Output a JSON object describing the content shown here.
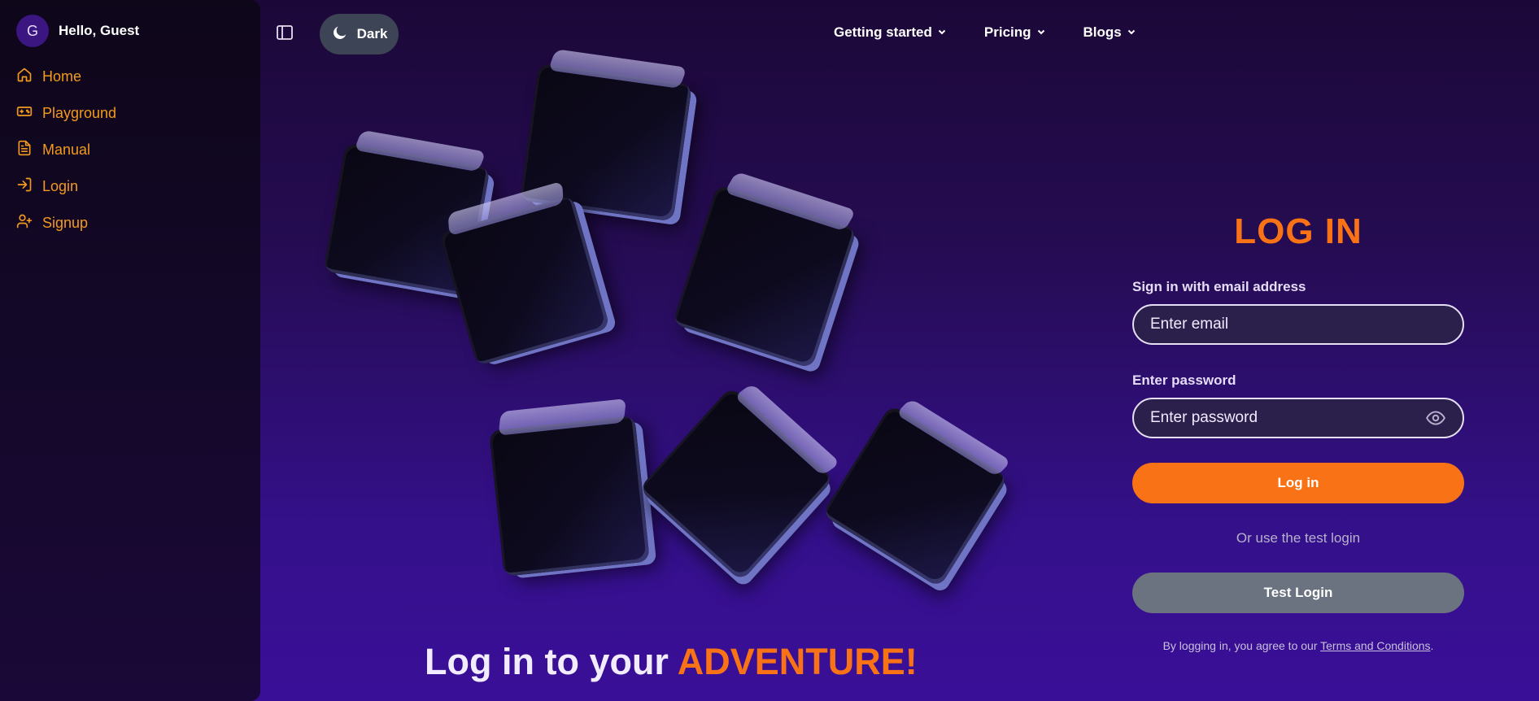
{
  "user": {
    "avatar_initial": "G",
    "greeting": "Hello, Guest"
  },
  "sidebar": {
    "items": [
      {
        "label": "Home",
        "icon": "home-icon"
      },
      {
        "label": "Playground",
        "icon": "gamepad-icon"
      },
      {
        "label": "Manual",
        "icon": "document-icon"
      },
      {
        "label": "Login",
        "icon": "login-icon"
      },
      {
        "label": "Signup",
        "icon": "user-plus-icon"
      }
    ]
  },
  "toolbar": {
    "sidebar_toggle_icon": "sidebar-toggle-icon",
    "theme_label": "Dark",
    "theme_icon": "moon-icon"
  },
  "topnav": {
    "items": [
      {
        "label": "Getting started"
      },
      {
        "label": "Pricing"
      },
      {
        "label": "Blogs"
      }
    ]
  },
  "hero": {
    "prefix": "Log in to your ",
    "accent": "ADVENTURE!"
  },
  "login": {
    "title": "LOG IN",
    "email_label": "Sign in with email address",
    "email_placeholder": "Enter email",
    "password_label": "Enter password",
    "password_placeholder": "Enter password",
    "login_button": "Log in",
    "or_text": "Or use the test login",
    "test_button": "Test Login",
    "terms_prefix": "By logging in, you agree to our ",
    "terms_link": "Terms and Conditions",
    "terms_suffix": "."
  },
  "colors": {
    "accent": "#f97316",
    "sidebar_link": "#f39a1e",
    "test_button": "#6b7280"
  }
}
